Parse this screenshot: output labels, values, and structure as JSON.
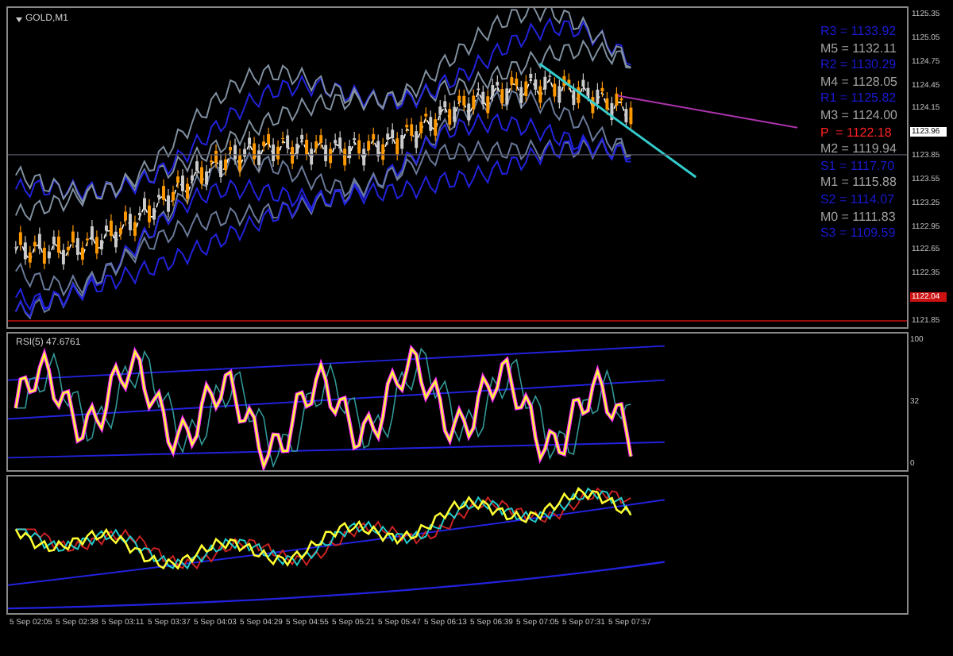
{
  "main_panel": {
    "title": "GOLD,M1",
    "pivots": [
      {
        "label": "R3 = 1133.92",
        "color": "#1a1ad0"
      },
      {
        "label": "M5 = 1132.11",
        "color": "#a0a0a0"
      },
      {
        "label": "R2 = 1130.29",
        "color": "#1a1ad0"
      },
      {
        "label": "M4 = 1128.05",
        "color": "#a0a0a0"
      },
      {
        "label": "R1 = 1125.82",
        "color": "#1a1ad0"
      },
      {
        "label": "M3 = 1124.00",
        "color": "#a0a0a0"
      },
      {
        "label": "P  = 1122.18",
        "color": "#ff2020"
      },
      {
        "label": "M2 = 1119.94",
        "color": "#a0a0a0"
      },
      {
        "label": "S1 = 1117.70",
        "color": "#1a1ad0"
      },
      {
        "label": "M1 = 1115.88",
        "color": "#a0a0a0"
      },
      {
        "label": "S2 = 1114.07",
        "color": "#1a1ad0"
      },
      {
        "label": "M0 = 1111.83",
        "color": "#a0a0a0"
      },
      {
        "label": "S3 = 1109.59",
        "color": "#1a1ad0"
      }
    ],
    "price_axis": [
      {
        "text": "1125.35",
        "kind": "tick"
      },
      {
        "text": "1125.05",
        "kind": "tick"
      },
      {
        "text": "1124.75",
        "kind": "tick"
      },
      {
        "text": "1124.45",
        "kind": "tick"
      },
      {
        "text": "1124.15",
        "kind": "tick"
      },
      {
        "text": "1123.96",
        "kind": "current"
      },
      {
        "text": "1123.85",
        "kind": "tick"
      },
      {
        "text": "1123.55",
        "kind": "tick"
      },
      {
        "text": "1123.25",
        "kind": "tick"
      },
      {
        "text": "1122.95",
        "kind": "tick"
      },
      {
        "text": "1122.65",
        "kind": "tick"
      },
      {
        "text": "1122.35",
        "kind": "tick"
      },
      {
        "text": "1122.04",
        "kind": "alert"
      },
      {
        "text": "1121.85",
        "kind": "tick"
      }
    ]
  },
  "rsi_panel": {
    "title": "RSI(5) 47.6761",
    "axis": [
      "100",
      "32",
      "0"
    ]
  },
  "time_axis": [
    "5 Sep 02:05",
    "5 Sep 02:38",
    "5 Sep 03:11",
    "5 Sep 03:37",
    "5 Sep 04:03",
    "5 Sep 04:29",
    "5 Sep 04:55",
    "5 Sep 05:21",
    "5 Sep 05:47",
    "5 Sep 06:13",
    "5 Sep 06:39",
    "5 Sep 07:05",
    "5 Sep 07:31",
    "5 Sep 07:57"
  ]
}
